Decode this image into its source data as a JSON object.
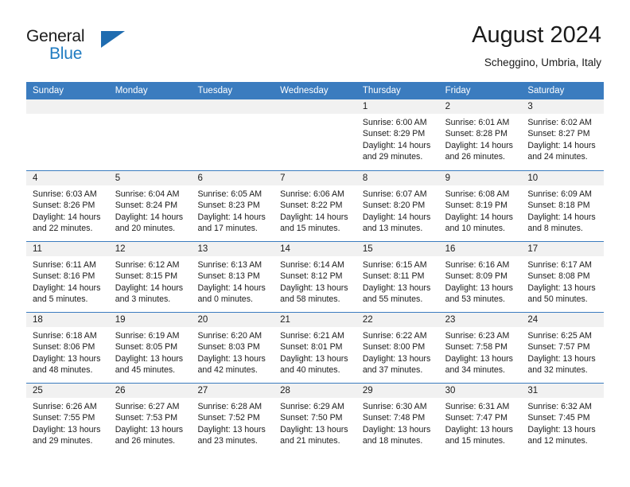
{
  "brand": {
    "word1": "General",
    "word2": "Blue",
    "flag_color": "#1f6cb0",
    "text_color": "#1b1b1b",
    "blue_color": "#1f7bc1",
    "logo_icon": "triangle-flag-icon"
  },
  "header": {
    "title": "August 2024",
    "subtitle": "Scheggino, Umbria, Italy"
  },
  "theme": {
    "header_bg": "#3b7cbf",
    "header_text": "#ffffff",
    "day_head_bg": "#f1f1f1",
    "cell_bg": "#ffffff",
    "row_border": "#3b7cbf"
  },
  "weekdays": [
    "Sunday",
    "Monday",
    "Tuesday",
    "Wednesday",
    "Thursday",
    "Friday",
    "Saturday"
  ],
  "weeks": [
    [
      {
        "day": "",
        "sunrise": "",
        "sunset": "",
        "daylight1": "",
        "daylight2": "",
        "empty": true
      },
      {
        "day": "",
        "sunrise": "",
        "sunset": "",
        "daylight1": "",
        "daylight2": "",
        "empty": true
      },
      {
        "day": "",
        "sunrise": "",
        "sunset": "",
        "daylight1": "",
        "daylight2": "",
        "empty": true
      },
      {
        "day": "",
        "sunrise": "",
        "sunset": "",
        "daylight1": "",
        "daylight2": "",
        "empty": true
      },
      {
        "day": "1",
        "sunrise": "Sunrise: 6:00 AM",
        "sunset": "Sunset: 8:29 PM",
        "daylight1": "Daylight: 14 hours",
        "daylight2": "and 29 minutes."
      },
      {
        "day": "2",
        "sunrise": "Sunrise: 6:01 AM",
        "sunset": "Sunset: 8:28 PM",
        "daylight1": "Daylight: 14 hours",
        "daylight2": "and 26 minutes."
      },
      {
        "day": "3",
        "sunrise": "Sunrise: 6:02 AM",
        "sunset": "Sunset: 8:27 PM",
        "daylight1": "Daylight: 14 hours",
        "daylight2": "and 24 minutes."
      }
    ],
    [
      {
        "day": "4",
        "sunrise": "Sunrise: 6:03 AM",
        "sunset": "Sunset: 8:26 PM",
        "daylight1": "Daylight: 14 hours",
        "daylight2": "and 22 minutes."
      },
      {
        "day": "5",
        "sunrise": "Sunrise: 6:04 AM",
        "sunset": "Sunset: 8:24 PM",
        "daylight1": "Daylight: 14 hours",
        "daylight2": "and 20 minutes."
      },
      {
        "day": "6",
        "sunrise": "Sunrise: 6:05 AM",
        "sunset": "Sunset: 8:23 PM",
        "daylight1": "Daylight: 14 hours",
        "daylight2": "and 17 minutes."
      },
      {
        "day": "7",
        "sunrise": "Sunrise: 6:06 AM",
        "sunset": "Sunset: 8:22 PM",
        "daylight1": "Daylight: 14 hours",
        "daylight2": "and 15 minutes."
      },
      {
        "day": "8",
        "sunrise": "Sunrise: 6:07 AM",
        "sunset": "Sunset: 8:20 PM",
        "daylight1": "Daylight: 14 hours",
        "daylight2": "and 13 minutes."
      },
      {
        "day": "9",
        "sunrise": "Sunrise: 6:08 AM",
        "sunset": "Sunset: 8:19 PM",
        "daylight1": "Daylight: 14 hours",
        "daylight2": "and 10 minutes."
      },
      {
        "day": "10",
        "sunrise": "Sunrise: 6:09 AM",
        "sunset": "Sunset: 8:18 PM",
        "daylight1": "Daylight: 14 hours",
        "daylight2": "and 8 minutes."
      }
    ],
    [
      {
        "day": "11",
        "sunrise": "Sunrise: 6:11 AM",
        "sunset": "Sunset: 8:16 PM",
        "daylight1": "Daylight: 14 hours",
        "daylight2": "and 5 minutes."
      },
      {
        "day": "12",
        "sunrise": "Sunrise: 6:12 AM",
        "sunset": "Sunset: 8:15 PM",
        "daylight1": "Daylight: 14 hours",
        "daylight2": "and 3 minutes."
      },
      {
        "day": "13",
        "sunrise": "Sunrise: 6:13 AM",
        "sunset": "Sunset: 8:13 PM",
        "daylight1": "Daylight: 14 hours",
        "daylight2": "and 0 minutes."
      },
      {
        "day": "14",
        "sunrise": "Sunrise: 6:14 AM",
        "sunset": "Sunset: 8:12 PM",
        "daylight1": "Daylight: 13 hours",
        "daylight2": "and 58 minutes."
      },
      {
        "day": "15",
        "sunrise": "Sunrise: 6:15 AM",
        "sunset": "Sunset: 8:11 PM",
        "daylight1": "Daylight: 13 hours",
        "daylight2": "and 55 minutes."
      },
      {
        "day": "16",
        "sunrise": "Sunrise: 6:16 AM",
        "sunset": "Sunset: 8:09 PM",
        "daylight1": "Daylight: 13 hours",
        "daylight2": "and 53 minutes."
      },
      {
        "day": "17",
        "sunrise": "Sunrise: 6:17 AM",
        "sunset": "Sunset: 8:08 PM",
        "daylight1": "Daylight: 13 hours",
        "daylight2": "and 50 minutes."
      }
    ],
    [
      {
        "day": "18",
        "sunrise": "Sunrise: 6:18 AM",
        "sunset": "Sunset: 8:06 PM",
        "daylight1": "Daylight: 13 hours",
        "daylight2": "and 48 minutes."
      },
      {
        "day": "19",
        "sunrise": "Sunrise: 6:19 AM",
        "sunset": "Sunset: 8:05 PM",
        "daylight1": "Daylight: 13 hours",
        "daylight2": "and 45 minutes."
      },
      {
        "day": "20",
        "sunrise": "Sunrise: 6:20 AM",
        "sunset": "Sunset: 8:03 PM",
        "daylight1": "Daylight: 13 hours",
        "daylight2": "and 42 minutes."
      },
      {
        "day": "21",
        "sunrise": "Sunrise: 6:21 AM",
        "sunset": "Sunset: 8:01 PM",
        "daylight1": "Daylight: 13 hours",
        "daylight2": "and 40 minutes."
      },
      {
        "day": "22",
        "sunrise": "Sunrise: 6:22 AM",
        "sunset": "Sunset: 8:00 PM",
        "daylight1": "Daylight: 13 hours",
        "daylight2": "and 37 minutes."
      },
      {
        "day": "23",
        "sunrise": "Sunrise: 6:23 AM",
        "sunset": "Sunset: 7:58 PM",
        "daylight1": "Daylight: 13 hours",
        "daylight2": "and 34 minutes."
      },
      {
        "day": "24",
        "sunrise": "Sunrise: 6:25 AM",
        "sunset": "Sunset: 7:57 PM",
        "daylight1": "Daylight: 13 hours",
        "daylight2": "and 32 minutes."
      }
    ],
    [
      {
        "day": "25",
        "sunrise": "Sunrise: 6:26 AM",
        "sunset": "Sunset: 7:55 PM",
        "daylight1": "Daylight: 13 hours",
        "daylight2": "and 29 minutes."
      },
      {
        "day": "26",
        "sunrise": "Sunrise: 6:27 AM",
        "sunset": "Sunset: 7:53 PM",
        "daylight1": "Daylight: 13 hours",
        "daylight2": "and 26 minutes."
      },
      {
        "day": "27",
        "sunrise": "Sunrise: 6:28 AM",
        "sunset": "Sunset: 7:52 PM",
        "daylight1": "Daylight: 13 hours",
        "daylight2": "and 23 minutes."
      },
      {
        "day": "28",
        "sunrise": "Sunrise: 6:29 AM",
        "sunset": "Sunset: 7:50 PM",
        "daylight1": "Daylight: 13 hours",
        "daylight2": "and 21 minutes."
      },
      {
        "day": "29",
        "sunrise": "Sunrise: 6:30 AM",
        "sunset": "Sunset: 7:48 PM",
        "daylight1": "Daylight: 13 hours",
        "daylight2": "and 18 minutes."
      },
      {
        "day": "30",
        "sunrise": "Sunrise: 6:31 AM",
        "sunset": "Sunset: 7:47 PM",
        "daylight1": "Daylight: 13 hours",
        "daylight2": "and 15 minutes."
      },
      {
        "day": "31",
        "sunrise": "Sunrise: 6:32 AM",
        "sunset": "Sunset: 7:45 PM",
        "daylight1": "Daylight: 13 hours",
        "daylight2": "and 12 minutes."
      }
    ]
  ]
}
